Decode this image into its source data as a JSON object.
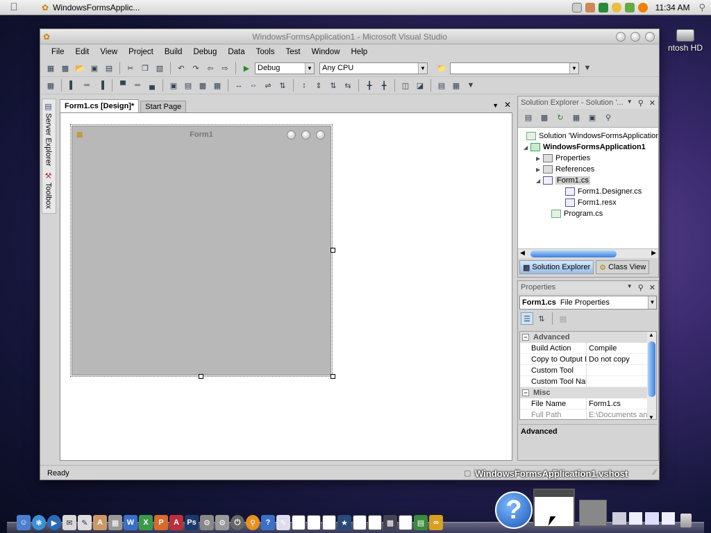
{
  "menubar": {
    "app_title": "WindowsFormsApplic...",
    "clock": "11:34 AM"
  },
  "desktop": {
    "hd_label": "ntosh HD"
  },
  "window": {
    "title": "WindowsFormsApplication1 - Microsoft Visual Studio",
    "menu": [
      "File",
      "Edit",
      "View",
      "Project",
      "Build",
      "Debug",
      "Data",
      "Tools",
      "Test",
      "Window",
      "Help"
    ],
    "config_combo": "Debug",
    "platform_combo": "Any CPU"
  },
  "rail": {
    "server_explorer": "Server Explorer",
    "toolbox": "Toolbox"
  },
  "doc": {
    "tab_active": "Form1.cs [Design]*",
    "tab_inactive": "Start Page",
    "form_title": "Form1"
  },
  "solution_explorer": {
    "title": "Solution Explorer - Solution '...",
    "nodes": {
      "solution": "Solution 'WindowsFormsApplication",
      "project": "WindowsFormsApplication1",
      "properties": "Properties",
      "references": "References",
      "form1": "Form1.cs",
      "designer": "Form1.Designer.cs",
      "resx": "Form1.resx",
      "program": "Program.cs"
    },
    "tab_solution": "Solution Explorer",
    "tab_class": "Class View"
  },
  "properties": {
    "title": "Properties",
    "object_name": "Form1.cs",
    "object_type": "File Properties",
    "cat_advanced": "Advanced",
    "cat_misc": "Misc",
    "rows": [
      {
        "key": "Build Action",
        "value": "Compile"
      },
      {
        "key": "Copy to Output D",
        "value": "Do not copy"
      },
      {
        "key": "Custom Tool",
        "value": ""
      },
      {
        "key": "Custom Tool Nam",
        "value": ""
      }
    ],
    "misc_rows": [
      {
        "key": "File Name",
        "value": "Form1.cs"
      },
      {
        "key": "Full Path",
        "value": "E:\\Documents and"
      }
    ],
    "description": "Advanced"
  },
  "status": {
    "text": "Ready",
    "tooltip": "WindowsFormsApplication1.vshost"
  },
  "colors": {
    "accent": "#3d7fd8",
    "selection": "#cfcfcf"
  }
}
